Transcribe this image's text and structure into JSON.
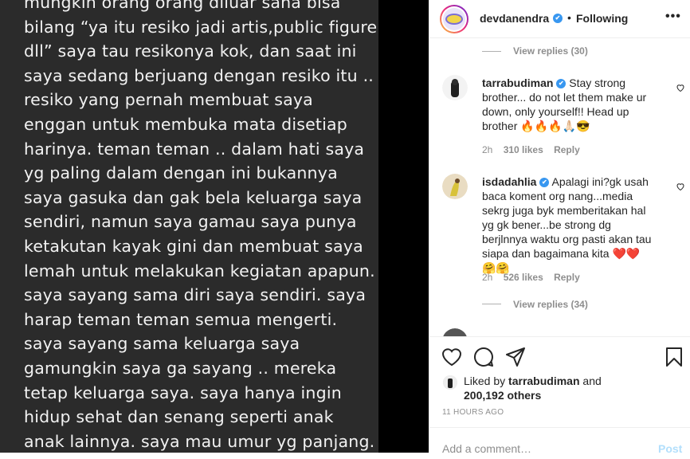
{
  "post_text": {
    "lines": [
      "mungkin orang orang diluar sana bisa",
      "bilang “ya itu resiko jadi artis,public figure",
      "dll” saya tau resikonya kok, dan saat ini",
      "saya sedang berjuang dengan resiko itu ..",
      "resiko yang pernah membuat saya",
      "enggan untuk membuka mata disetiap",
      "harinya. teman teman .. dalam hati saya",
      "yg paling dalam dengan ini bukannya",
      "saya gasuka dan gak bela keluarga saya",
      "sendiri, namun saya gamau saya punya",
      "ketakutan kayak gini dan membuat saya",
      "lemah untuk melakukan kegiatan apapun.",
      "saya sayang sama diri saya sendiri. saya",
      "harap teman teman semua mengerti.",
      "saya sayang sama keluarga saya",
      "gamungkin saya ga sayang .. mereka",
      "tetap keluarga saya. saya hanya ingin",
      "hidup sehat dan senang seperti anak",
      "anak lainnya. saya mau umur yg panjang."
    ]
  },
  "header": {
    "username": "devdanendra",
    "verified": "✔",
    "separator": "•",
    "follow_status": "Following",
    "more": "•••"
  },
  "comments": {
    "top_view_replies": "View replies (30)",
    "items": [
      {
        "username": "tarrabudiman",
        "text": " Stay strong brother... do not let them make ur down, only yourself!! Head up brother 🔥🔥🔥🙏🏻😎",
        "time": "2h",
        "likes": "310 likes",
        "reply": "Reply"
      },
      {
        "username": "isdadahlia",
        "text": " Apalagi ini?gk usah baca koment org nang...media sekrg juga byk memberitakan hal yg gk bener...be strong dg berjlnnya waktu org pasti akan tau siapa dan bagaimana kita ❤️❤️🤗🤗",
        "time": "2h",
        "likes": "526 likes",
        "reply": "Reply",
        "view_replies": "View replies (34)"
      }
    ]
  },
  "actions": {
    "liked_by_prefix": "Liked by",
    "liked_by_user": "tarrabudiman",
    "liked_by_and": "and",
    "others": "200,192 others",
    "time_ago": "11 HOURS AGO"
  },
  "add_comment": {
    "placeholder": "Add a comment…",
    "post_label": "Post"
  },
  "colors": {
    "accent_blue": "#3897f0",
    "post_disabled": "#b2dffc",
    "muted": "#8e8e8e",
    "text": "#262626"
  },
  "icons": [
    "heart-icon",
    "comment-icon",
    "share-icon",
    "bookmark-icon",
    "more-options-icon",
    "verified-badge-icon"
  ]
}
